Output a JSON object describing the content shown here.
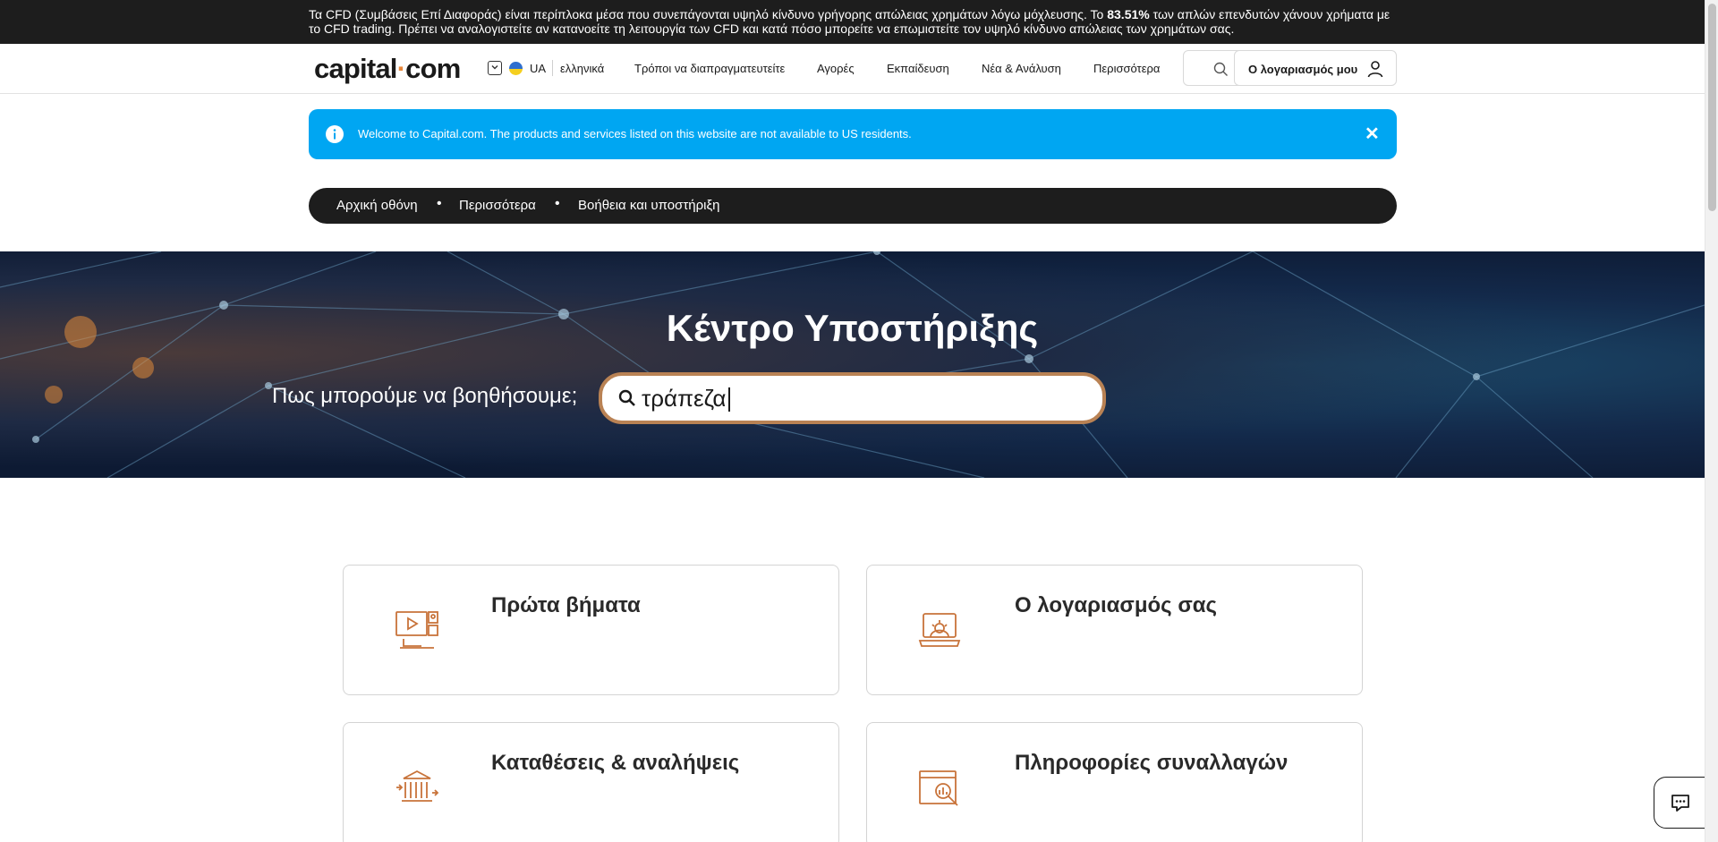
{
  "risk_warning": {
    "text_before": "Τα CFD (Συμβάσεις Επί Διαφοράς) είναι περίπλοκα μέσα που συνεπάγονται υψηλό κίνδυνο γρήγορης απώλειας χρημάτων λόγω μόχλευσης. Το ",
    "percentage": "83.51%",
    "text_after": " των απλών επενδυτών χάνουν χρήματα με το CFD trading. Πρέπει να αναλογιστείτε αν κατανοείτε τη λειτουργία των CFD και κατά πόσο μπορείτε να επωμιστείτε τον υψηλό κίνδυνο απώλειας των χρημάτων σας."
  },
  "header": {
    "logo_left": "capital",
    "logo_dot": "·",
    "logo_right": "com",
    "lang_code": "UA",
    "lang_name": "ελληνικά",
    "nav": [
      "Τρόποι να διαπραγματευτείτε",
      "Αγορές",
      "Εκπαίδευση",
      "Νέα & Ανάλυση",
      "Περισσότερα"
    ],
    "account_label": "Ο λογαριασμός μου"
  },
  "info_banner": {
    "message": "Welcome to Capital.com. The products and services listed on this website are not available to US residents.",
    "close": "✕"
  },
  "breadcrumb": {
    "items": [
      "Αρχική οθόνη",
      "Περισσότερα",
      "Βοήθεια και υποστήριξη"
    ],
    "separator": "•"
  },
  "hero": {
    "title": "Κέντρο Υποστήριξης",
    "prompt": "Πως μπορούμε να βοηθήσουμε;",
    "search_value": "τράπεζα"
  },
  "cards": [
    {
      "title": "Πρώτα βήματα",
      "icon": "video-tutorial-icon"
    },
    {
      "title": "Ο λογαριασμός σας",
      "icon": "laptop-settings-icon"
    },
    {
      "title": "Καταθέσεις & αναλήψεις",
      "icon": "bank-transfer-icon"
    },
    {
      "title": "Πληροφορίες συναλλαγών",
      "icon": "chart-magnifier-icon"
    }
  ],
  "colors": {
    "accent": "#00a6f2",
    "dark": "#1d1d1d",
    "icon_orange": "#c8733a",
    "search_border": "#b98254"
  }
}
